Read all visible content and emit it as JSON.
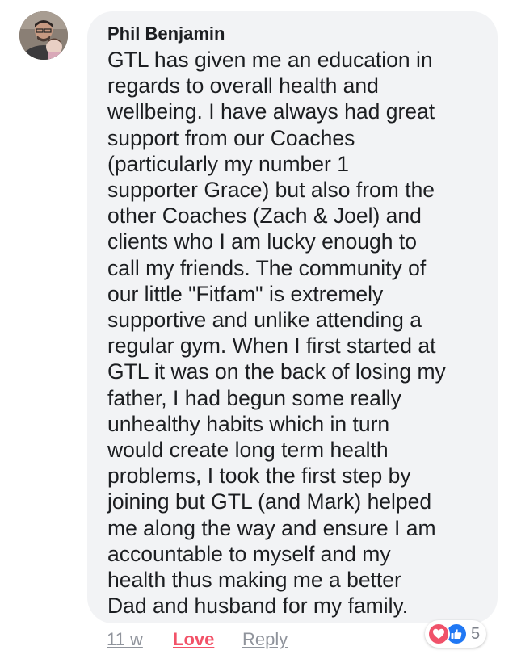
{
  "comment": {
    "author": "Phil Benjamin",
    "text": "GTL has given me an education in\nregards to overall health and\nwellbeing. I have always had great\nsupport from our Coaches\n(particularly my number 1\nsupporter Grace) but also from the\nother Coaches (Zach & Joel) and\nclients who I am lucky enough to\ncall my friends. The community of\nour little \"Fitfam\" is extremely\nsupportive and unlike attending a\nregular gym. When I first started at\nGTL it was on the back of losing my\nfather, I had begun some really\nunhealthy habits which in turn\nwould create long term health\nproblems, I took the first step by\njoining but GTL (and Mark) helped\nme along the way and ensure I am\naccountable to myself and my\nhealth thus making me a better\nDad and husband for my family."
  },
  "meta": {
    "time": "11 w",
    "love_label": "Love",
    "reply_label": "Reply"
  },
  "reactions": {
    "count": "5",
    "icons": [
      "love-icon",
      "like-icon"
    ]
  },
  "colors": {
    "bubble_bg": "#f2f3f5",
    "love": "#f0526a",
    "like": "#2078f4",
    "meta_text": "#90949c"
  }
}
